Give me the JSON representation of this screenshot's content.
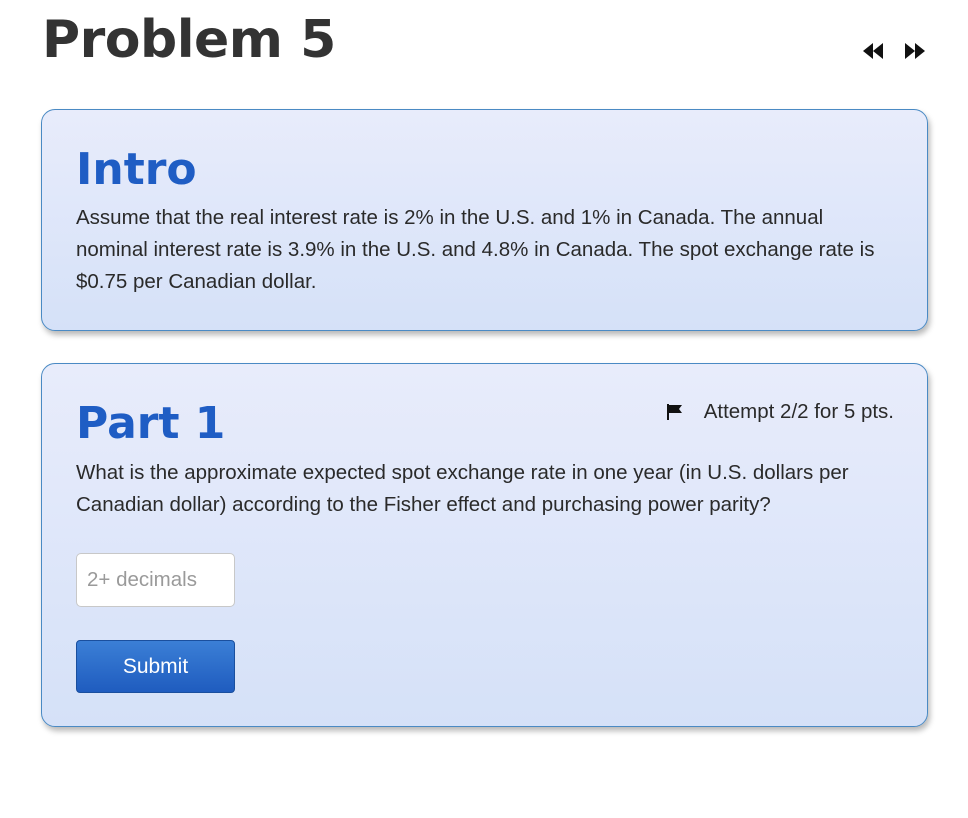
{
  "page": {
    "title": "Problem 5"
  },
  "nav": {
    "prev_icon": "rewind-icon",
    "next_icon": "fast-forward-icon"
  },
  "intro": {
    "heading": "Intro",
    "text": "Assume that the real interest rate is 2% in the U.S. and 1% in Canada. The annual nominal interest rate is 3.9% in the U.S. and 4.8% in Canada. The spot exchange rate is $0.75 per Canadian dollar."
  },
  "part1": {
    "heading": "Part 1",
    "flag_icon": "flag-icon",
    "attempt": "Attempt 2/2 for 5 pts.",
    "question": "What is the approximate expected spot exchange rate in one year (in U.S. dollars per Canadian dollar) according to the Fisher effect and purchasing power parity?",
    "answer_value": "",
    "answer_placeholder": "2+ decimals",
    "submit_label": "Submit"
  },
  "colors": {
    "heading": "#1f5dc4",
    "card_border": "#4a8ac4",
    "submit_bg": "#2a6dcc"
  }
}
